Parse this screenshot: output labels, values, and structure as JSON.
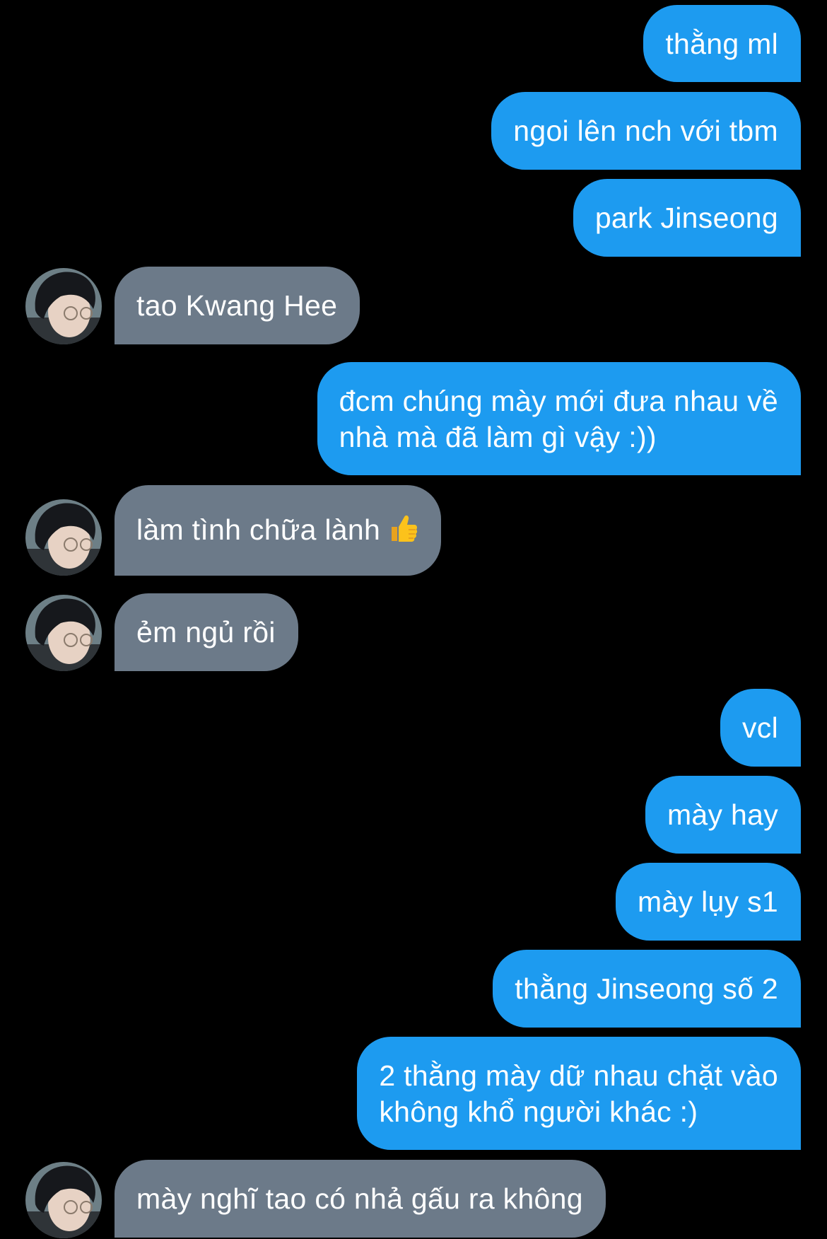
{
  "theme": {
    "background": "#000000",
    "sent_bubble_color": "#1d9bf0",
    "received_bubble_color": "#6c7a89",
    "text_color": "#ffffff"
  },
  "messages": [
    {
      "from": "me",
      "text": "thằng ml"
    },
    {
      "from": "me",
      "text": "ngoi lên nch với tbm"
    },
    {
      "from": "me",
      "text": "park Jinseong"
    },
    {
      "from": "other",
      "text": "tao Kwang Hee",
      "avatar": "avatar-icon"
    },
    {
      "from": "me",
      "lines": [
        "đcm chúng mày mới đưa nhau về",
        "nhà mà đã làm gì vậy :))"
      ]
    },
    {
      "from": "other",
      "text": "làm tình chữa lành",
      "emoji": "thumbs-up-icon",
      "avatar": "avatar-icon"
    },
    {
      "from": "other",
      "text": "ẻm ngủ rồi",
      "avatar": "avatar-icon"
    },
    {
      "from": "me",
      "text": "vcl"
    },
    {
      "from": "me",
      "text": "mày hay"
    },
    {
      "from": "me",
      "text": "mày lụy s1"
    },
    {
      "from": "me",
      "text": "thằng Jinseong số 2"
    },
    {
      "from": "me",
      "lines": [
        "2 thằng mày dữ nhau chặt vào",
        "không khổ người khác :)"
      ]
    },
    {
      "from": "other",
      "text": "mày nghĩ tao có nhả gấu ra không",
      "avatar": "avatar-icon"
    }
  ]
}
